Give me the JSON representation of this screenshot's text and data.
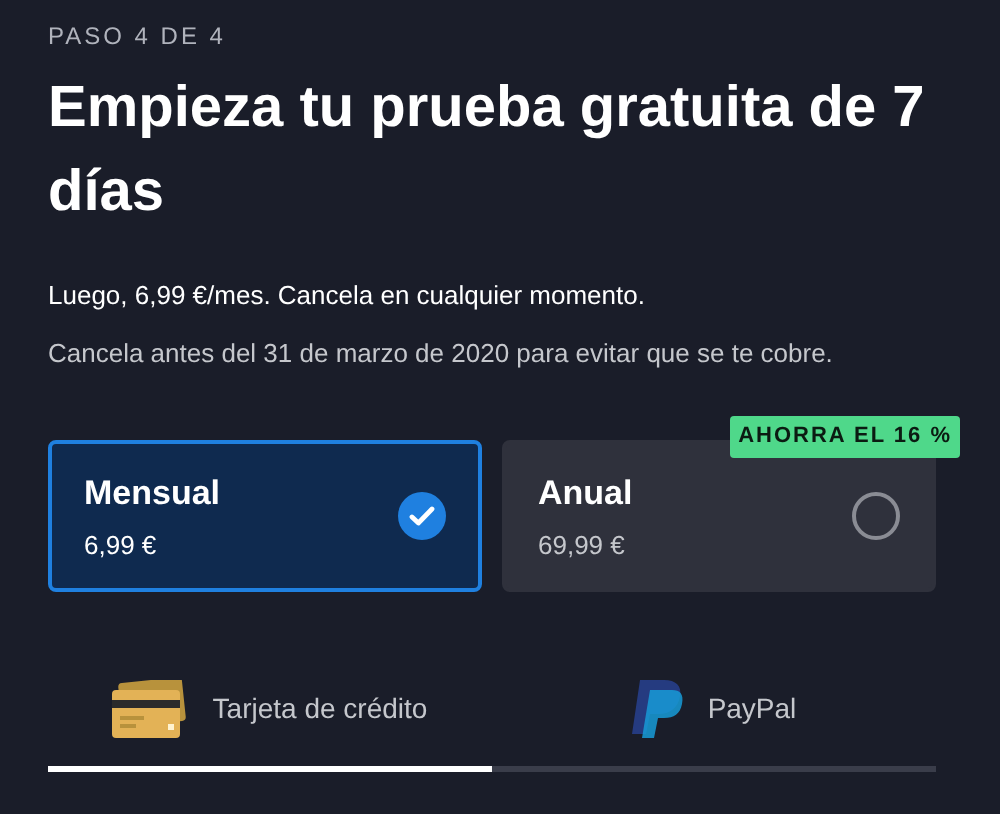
{
  "step": "PASO 4 DE 4",
  "title": "Empieza tu prueba gratuita de 7 días",
  "subtitle": "Luego, 6,99 €/mes. Cancela en cualquier momento.",
  "note": "Cancela antes del 31 de marzo de 2020 para evitar que se te cobre.",
  "plans": [
    {
      "name": "Mensual",
      "price": "6,99 €",
      "selected": true
    },
    {
      "name": "Anual",
      "price": "69,99 €",
      "selected": false,
      "badge": "AHORRA EL 16 %"
    }
  ],
  "payment_tabs": [
    {
      "kind": "card",
      "label": "Tarjeta de crédito",
      "selected": true
    },
    {
      "kind": "paypal",
      "label": "PayPal",
      "selected": false
    }
  ]
}
